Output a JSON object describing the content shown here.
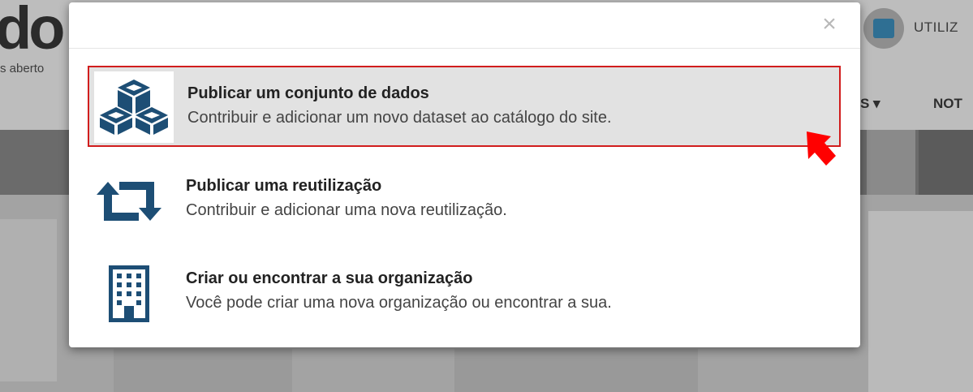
{
  "background": {
    "logo_text": "do",
    "tagline": "s aberto",
    "user_label": "UTILIZ",
    "nav_item_1": "S ▾",
    "nav_item_2": "NOT"
  },
  "modal": {
    "close_label": "×",
    "options": [
      {
        "title": "Publicar um conjunto de dados",
        "description": "Contribuir e adicionar um novo dataset ao catálogo do site.",
        "icon": "cubes-icon",
        "highlighted": true
      },
      {
        "title": "Publicar uma reutilização",
        "description": "Contribuir e adicionar uma nova reutilização.",
        "icon": "retweet-icon",
        "highlighted": false
      },
      {
        "title": "Criar ou encontrar a sua organização",
        "description": "Você pode criar uma nova organização ou encontrar a sua.",
        "icon": "building-icon",
        "highlighted": false
      }
    ]
  },
  "colors": {
    "icon_color": "#1d4e75",
    "highlight_border": "#d11d1d",
    "arrow_color": "#ff0000"
  }
}
